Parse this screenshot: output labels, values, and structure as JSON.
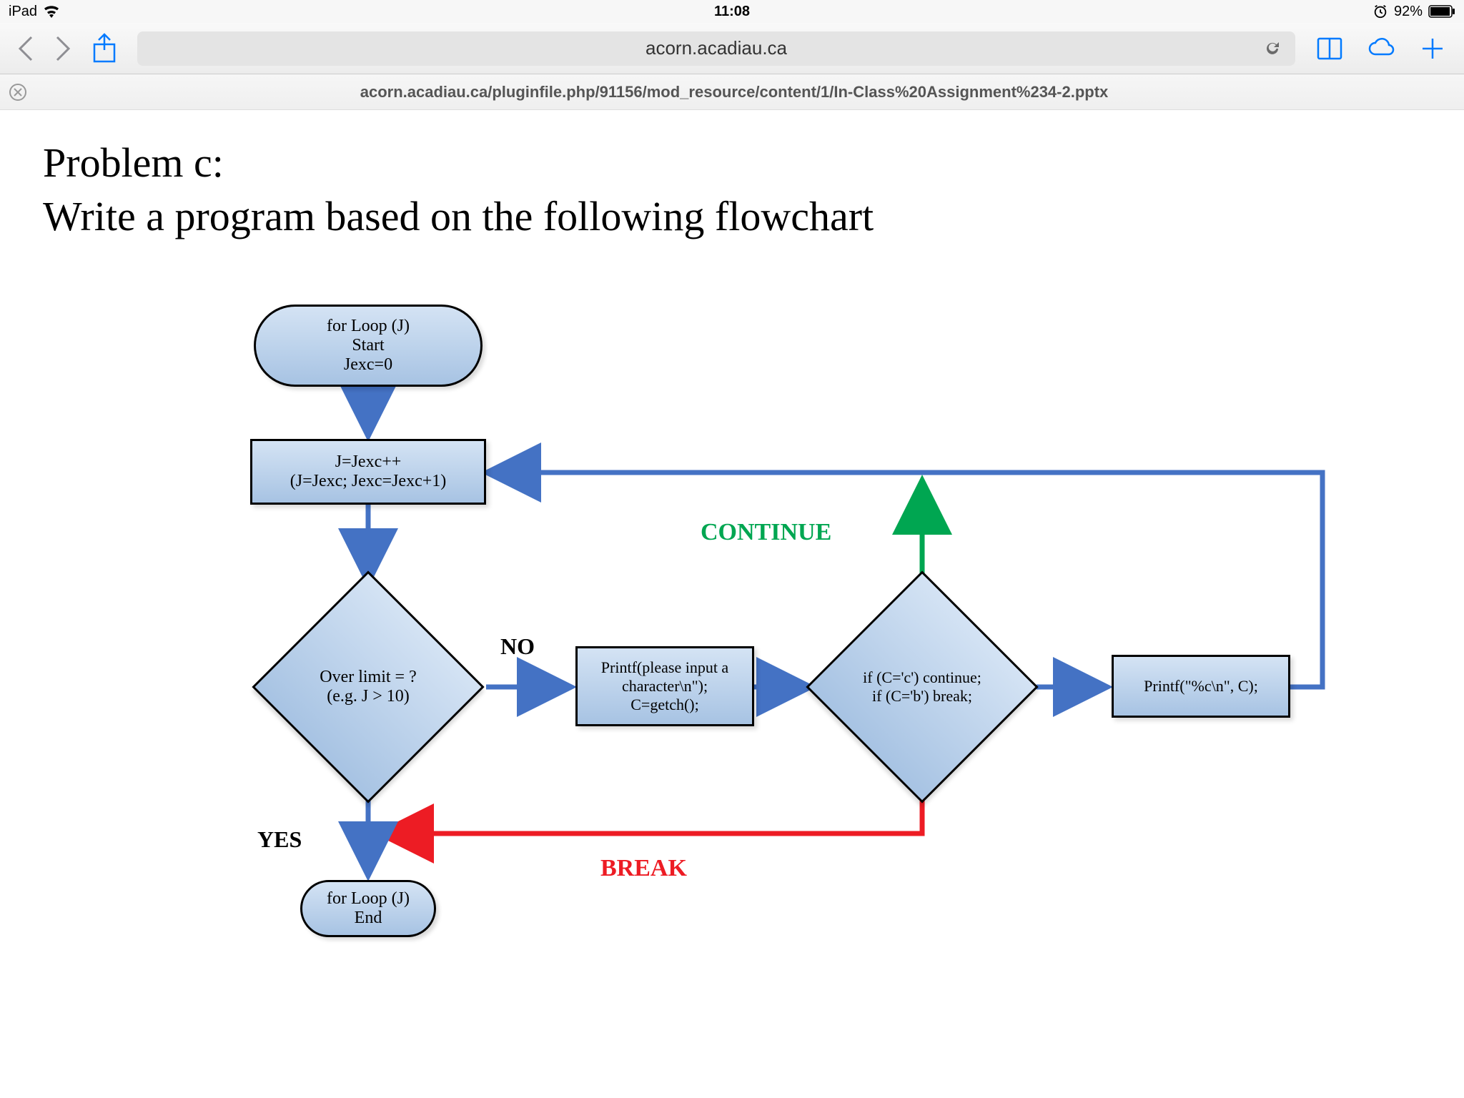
{
  "status_bar": {
    "device": "iPad",
    "time": "11:08",
    "battery_pct": "92%"
  },
  "browser": {
    "url": "acorn.acadiau.ca",
    "full_url": "acorn.acadiau.ca/pluginfile.php/91156/mod_resource/content/1/In-Class%20Assignment%234-2.pptx"
  },
  "document": {
    "title": "Problem c:",
    "subtitle": "Write a program based on the following flowchart"
  },
  "flowchart": {
    "start": {
      "line1": "for Loop (J)",
      "line2": "Start",
      "line3": "Jexc=0"
    },
    "increment": {
      "line1": "J=Jexc++",
      "line2": "(J=Jexc;  Jexc=Jexc+1)"
    },
    "decision1": {
      "line1": "Over limit  = ?",
      "line2": "(e.g. J > 10)"
    },
    "input_block": {
      "line1": "Printf(please input a",
      "line2": "character\\n\");",
      "line3": "C=getch();"
    },
    "decision2": {
      "line1": "if (C='c') continue;",
      "line2": "if (C='b') break;"
    },
    "output_block": {
      "line1": "Printf(\"%c\\n\", C);"
    },
    "end": {
      "line1": "for Loop (J)",
      "line2": "End"
    },
    "labels": {
      "no": "NO",
      "yes": "YES",
      "continue": "CONTINUE",
      "break": "BREAK"
    },
    "colors": {
      "blue": "#4472c4",
      "green": "#00a651",
      "red": "#ed1c24"
    }
  }
}
